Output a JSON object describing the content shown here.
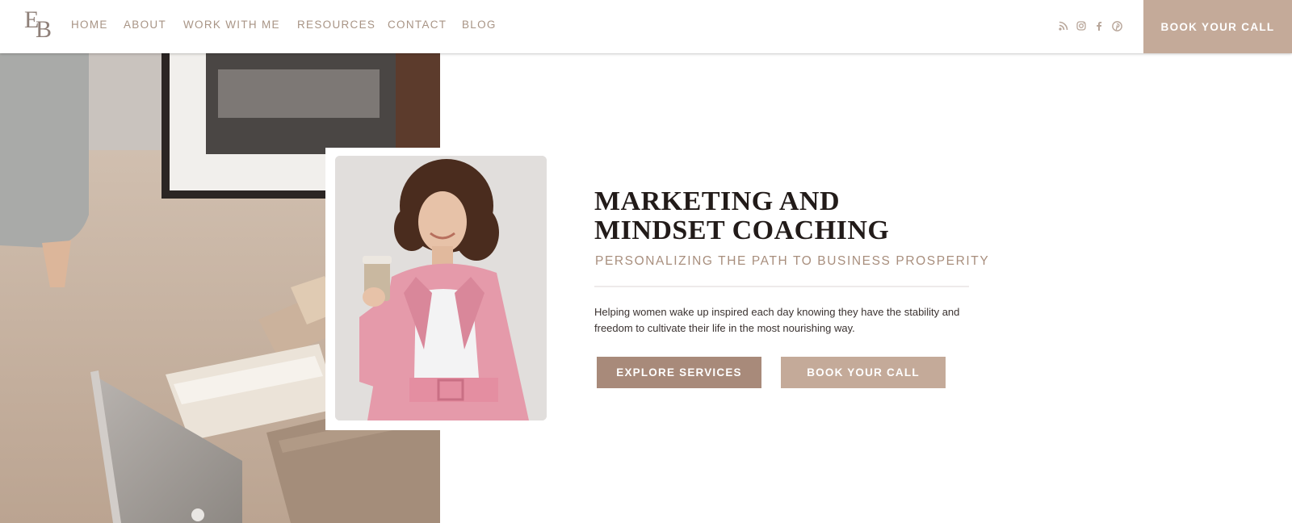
{
  "brand": {
    "logo_letter_1": "E",
    "logo_letter_2": "B"
  },
  "nav": {
    "items": [
      "HOME",
      "ABOUT",
      "WORK WITH ME",
      "RESOURCES",
      "CONTACT",
      "BLOG"
    ]
  },
  "social": {
    "icons": [
      "rss-icon",
      "instagram-icon",
      "facebook-icon",
      "pinterest-icon"
    ]
  },
  "header_cta": {
    "label": "BOOK YOUR CALL"
  },
  "hero": {
    "title_line_1": "MARKETING AND",
    "title_line_2": "MINDSET COACHING",
    "subtitle": "PERSONALIZING THE PATH TO BUSINESS PROSPERITY",
    "body": "Helping women wake up inspired each day knowing they have the stability and freedom to cultivate their life in the most nourishing way.",
    "primary_button": "EXPLORE SERVICES",
    "secondary_button": "BOOK YOUR CALL"
  },
  "colors": {
    "accent": "#c4aa99",
    "accent_dark": "#a88a7a",
    "nav_text": "#a89485",
    "heading": "#221b19"
  }
}
